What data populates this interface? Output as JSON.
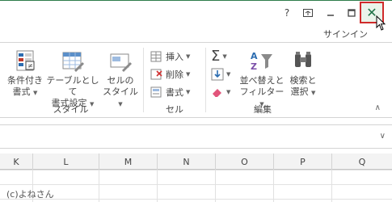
{
  "titlebar": {
    "help": "?",
    "close": "✕"
  },
  "account": {
    "signin": "サインイン"
  },
  "ribbon": {
    "styles_group": {
      "label": "スタイル",
      "conditional_format": [
        "条件付き",
        "書式"
      ],
      "format_as_table": [
        "テーブルとして",
        "書式設定"
      ],
      "cell_styles": [
        "セルの",
        "スタイル"
      ]
    },
    "cells_group": {
      "label": "セル",
      "insert": "挿入",
      "delete": "削除",
      "format": "書式"
    },
    "editing_group": {
      "label": "編集",
      "sort_filter": [
        "並べ替えと",
        "フィルター"
      ],
      "find_select": [
        "検索と",
        "選択"
      ]
    }
  },
  "sheet": {
    "columns": [
      "K",
      "L",
      "M",
      "N",
      "O",
      "P",
      "Q"
    ],
    "credit": "(c)よねさん"
  }
}
